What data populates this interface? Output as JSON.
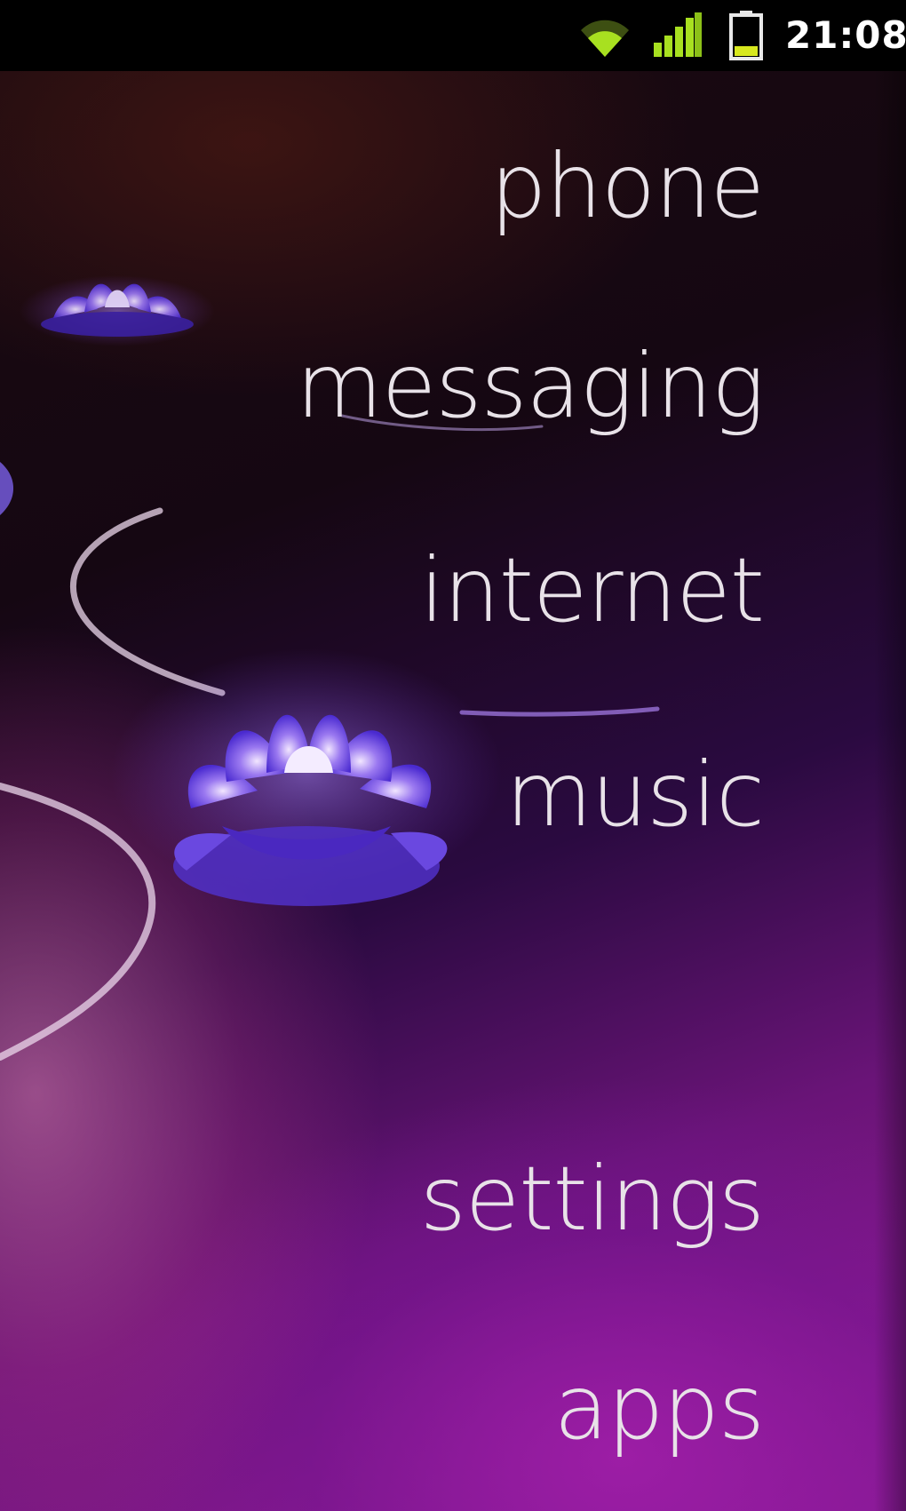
{
  "status_bar": {
    "time": "21:08",
    "icons": {
      "wifi": "wifi-icon",
      "signal": "signal-icon",
      "battery": "battery-icon"
    },
    "accent_color": "#a8e020"
  },
  "menu": {
    "items": [
      {
        "id": "phone",
        "label": "phone"
      },
      {
        "id": "messaging",
        "label": "messaging"
      },
      {
        "id": "internet",
        "label": "internet"
      },
      {
        "id": "music",
        "label": "music"
      },
      {
        "id": "settings",
        "label": "settings"
      },
      {
        "id": "apps",
        "label": "apps"
      }
    ],
    "text_color": "#e8e2e8"
  },
  "wallpaper": {
    "description": "purple lotus flowers",
    "colors": [
      "#150712",
      "#6a1478",
      "#9a1e98"
    ]
  }
}
